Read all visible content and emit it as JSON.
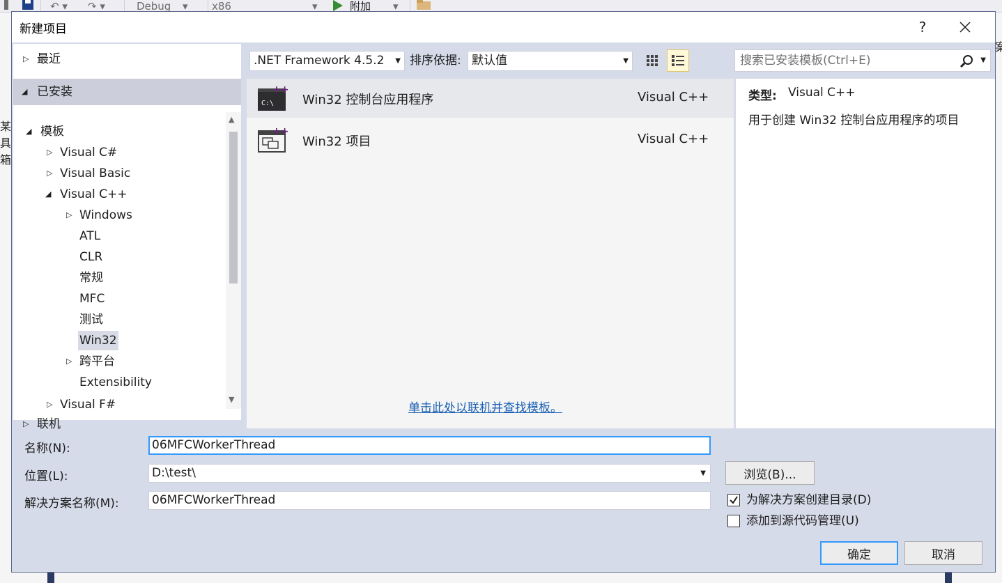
{
  "ide": {
    "toolbar": {
      "config": "Debug",
      "platform": "x86",
      "attach_label": "附加",
      "right_cutoff": "案"
    },
    "left_cutoff": [
      "某",
      "具箱"
    ]
  },
  "dialog": {
    "title": "新建项目",
    "help_label": "?",
    "close_label": "✕"
  },
  "nav": {
    "recent": "最近",
    "installed": "已安装",
    "online": "联机",
    "tree": {
      "templates": "模板",
      "visual_csharp": "Visual C#",
      "visual_basic": "Visual Basic",
      "visual_cpp": "Visual C++",
      "windows": "Windows",
      "atl": "ATL",
      "clr": "CLR",
      "general": "常规",
      "mfc": "MFC",
      "test": "测试",
      "win32": "Win32",
      "cross_platform": "跨平台",
      "extensibility": "Extensibility",
      "visual_fsharp": "Visual F#"
    }
  },
  "toolbar": {
    "framework": ".NET Framework 4.5.2",
    "sort_label": "排序依据:",
    "sort_value": "默认值",
    "search_placeholder": "搜索已安装模板(Ctrl+E)"
  },
  "templates": [
    {
      "name": "Win32 控制台应用程序",
      "lang": "Visual C++",
      "icon": "console-app-icon"
    },
    {
      "name": "Win32 项目",
      "lang": "Visual C++",
      "icon": "win32-project-icon"
    }
  ],
  "online_link": "单击此处以联机并查找模板。",
  "description": {
    "type_label": "类型:",
    "type_value": "Visual C++",
    "text": "用于创建 Win32 控制台应用程序的项目"
  },
  "form": {
    "name_label": "名称(N):",
    "name_value": "06MFCWorkerThread",
    "location_label": "位置(L):",
    "location_value": "D:\\test\\",
    "solution_label": "解决方案名称(M):",
    "solution_value": "06MFCWorkerThread",
    "browse_label": "浏览(B)...",
    "create_dir_label": "为解决方案创建目录(D)",
    "create_dir_checked": true,
    "source_control_label": "添加到源代码管理(U)",
    "source_control_checked": false,
    "ok_label": "确定",
    "cancel_label": "取消"
  },
  "colors": {
    "dialog_bg": "#d6dbe9",
    "selection": "#cccedb",
    "focus": "#3399ff",
    "link": "#1a5fb4",
    "cpp_purple": "#68217a"
  }
}
